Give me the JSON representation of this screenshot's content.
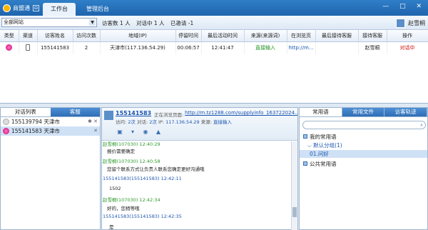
{
  "app": {
    "title": "商盟通",
    "tabs": [
      "工作台",
      "管理后台"
    ],
    "window_controls": "— □ ✕"
  },
  "toolbar": {
    "site_select": "全部网站",
    "stats": {
      "visitors_label": "访客数",
      "visitors": "1",
      "chatting_label": "对话中",
      "chatting": "1",
      "invited_label": "已邀请",
      "invited": "-1"
    },
    "user_name": "赵雪桐"
  },
  "visitor_table": {
    "headers": [
      "类型",
      "渠道",
      "访客姓名",
      "访问次数",
      "地域(IP)",
      "停留时间",
      "最后活动时间",
      "来源(来源词)",
      "在浏览页",
      "最后接待客服",
      "接待客服",
      "操作"
    ],
    "rows": [
      {
        "name": "155141583",
        "visits": "2",
        "region": "天津市(117.136.54.29)",
        "stay": "00:06:57",
        "last_active": "12:41:47",
        "source": "直接输入",
        "page": "http://m...",
        "last_agent": "",
        "agent": "赵雪桐",
        "op": "对话中"
      }
    ]
  },
  "left_panel": {
    "tabs": [
      "对话列表",
      "客服"
    ],
    "conversations": [
      {
        "id": "155139794",
        "city": "天津市",
        "ctl": "✱ ✕"
      },
      {
        "id": "155141583",
        "city": "天津市",
        "ctl": "✕"
      }
    ]
  },
  "chat": {
    "visitor_id": "155141583",
    "browsing_label": "正在浏览页面:",
    "url": "http://m.tz1288.com/supplyinfo_163722024....",
    "info": {
      "visits_label": "访问:",
      "visits": "2次",
      "chats_label": "对话:",
      "chats": "2次",
      "ip_label": "IP:",
      "ip": "117.136.54.29",
      "src_label": "来源:",
      "src": "直接输入"
    },
    "messages": [
      {
        "head": "赵雪桐(107030) 12:40:29",
        "body": "报价需要确定",
        "who": "agent"
      },
      {
        "head": "赵雪桐(107030) 12:40:58",
        "body": "您留个联系方式让负责人联系您确定更好沟通哦",
        "who": "agent"
      },
      {
        "head": "155141583(155141583) 12:42:11",
        "body": "1502",
        "who": "visitor"
      },
      {
        "head": "赵雪桐(107030) 12:42:34",
        "body": "好的，您稍等哦",
        "who": "agent"
      },
      {
        "head": "155141583(155141583) 12:42:35",
        "body": "是",
        "who": "visitor"
      }
    ]
  },
  "right_panel": {
    "tabs": [
      "常用语",
      "常用文件",
      "访客轨迹"
    ],
    "tree": {
      "mine": "我的常用语",
      "default_group": "默认分组(1)",
      "item": "01.问好",
      "public": "公共常用语"
    }
  }
}
